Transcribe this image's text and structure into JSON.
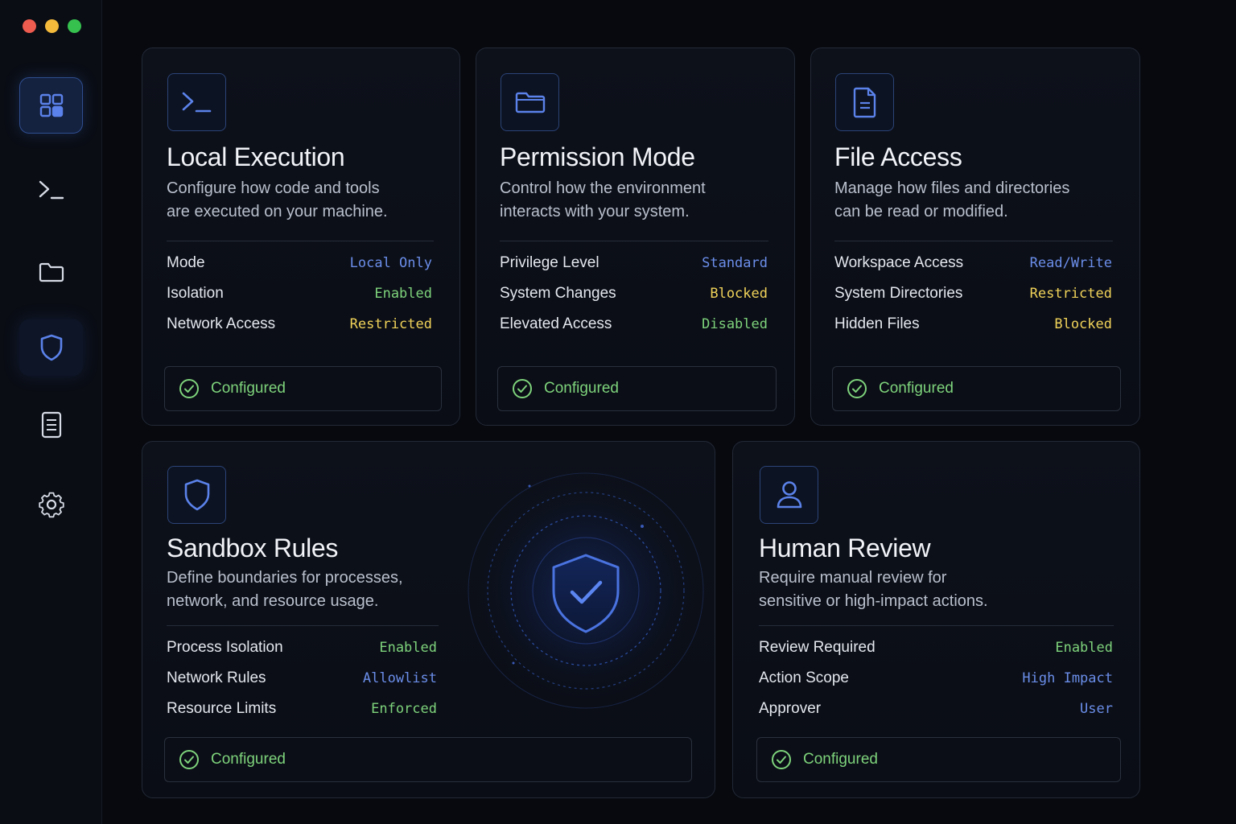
{
  "window": {
    "controls": [
      "close",
      "minimize",
      "zoom"
    ]
  },
  "sidebar": {
    "items": [
      {
        "id": "dashboard",
        "icon": "dashboard-grid-icon",
        "active": true
      },
      {
        "id": "terminal",
        "icon": "terminal-icon"
      },
      {
        "id": "files",
        "icon": "folder-icon"
      },
      {
        "id": "security",
        "icon": "shield-icon",
        "highlighted": true
      },
      {
        "id": "documents",
        "icon": "document-icon"
      },
      {
        "id": "settings",
        "icon": "gear-icon"
      }
    ]
  },
  "colors": {
    "accent": "#4f73d9",
    "ok": "#7ed37c",
    "warn": "#f1d35a",
    "info": "#6b8eea"
  },
  "cards": {
    "local_execution": {
      "icon": "terminal-icon",
      "title": "Local Execution",
      "desc_line1": "Configure how code and tools",
      "desc_line2": "are executed on your machine.",
      "rows": [
        {
          "label": "Mode",
          "value": "Local Only",
          "tone": "blue"
        },
        {
          "label": "Isolation",
          "value": "Enabled",
          "tone": "green"
        },
        {
          "label": "Network Access",
          "value": "Restricted",
          "tone": "yellow"
        }
      ],
      "status": "Configured"
    },
    "permission_mode": {
      "icon": "folder-icon",
      "title": "Permission Mode",
      "desc_line1": "Control how the environment",
      "desc_line2": "interacts with your system.",
      "rows": [
        {
          "label": "Privilege Level",
          "value": "Standard",
          "tone": "blue"
        },
        {
          "label": "System Changes",
          "value": "Blocked",
          "tone": "yellow"
        },
        {
          "label": "Elevated Access",
          "value": "Disabled",
          "tone": "green"
        }
      ],
      "status": "Configured"
    },
    "file_access": {
      "icon": "document-icon",
      "title": "File Access",
      "desc_line1": "Manage how files and directories",
      "desc_line2": "can be read or modified.",
      "rows": [
        {
          "label": "Workspace Access",
          "value": "Read/Write",
          "tone": "blue"
        },
        {
          "label": "System Directories",
          "value": "Restricted",
          "tone": "yellow"
        },
        {
          "label": "Hidden Files",
          "value": "Blocked",
          "tone": "yellow"
        }
      ],
      "status": "Configured"
    },
    "sandbox_rules": {
      "icon": "shield-icon",
      "title": "Sandbox Rules",
      "desc_line1": "Define boundaries for processes,",
      "desc_line2": "network, and resource usage.",
      "rows": [
        {
          "label": "Process Isolation",
          "value": "Enabled",
          "tone": "green"
        },
        {
          "label": "Network Rules",
          "value": "Allowlist",
          "tone": "blue"
        },
        {
          "label": "Resource Limits",
          "value": "Enforced",
          "tone": "green"
        }
      ],
      "status": "Configured",
      "hero_icon": "shield-check-icon"
    },
    "human_review": {
      "icon": "user-icon",
      "title": "Human Review",
      "desc_line1": "Require manual review for",
      "desc_line2": "sensitive or high-impact actions.",
      "rows": [
        {
          "label": "Review Required",
          "value": "Enabled",
          "tone": "green"
        },
        {
          "label": "Action Scope",
          "value": "High Impact",
          "tone": "blue"
        },
        {
          "label": "Approver",
          "value": "User",
          "tone": "blue"
        }
      ],
      "status": "Configured"
    }
  }
}
